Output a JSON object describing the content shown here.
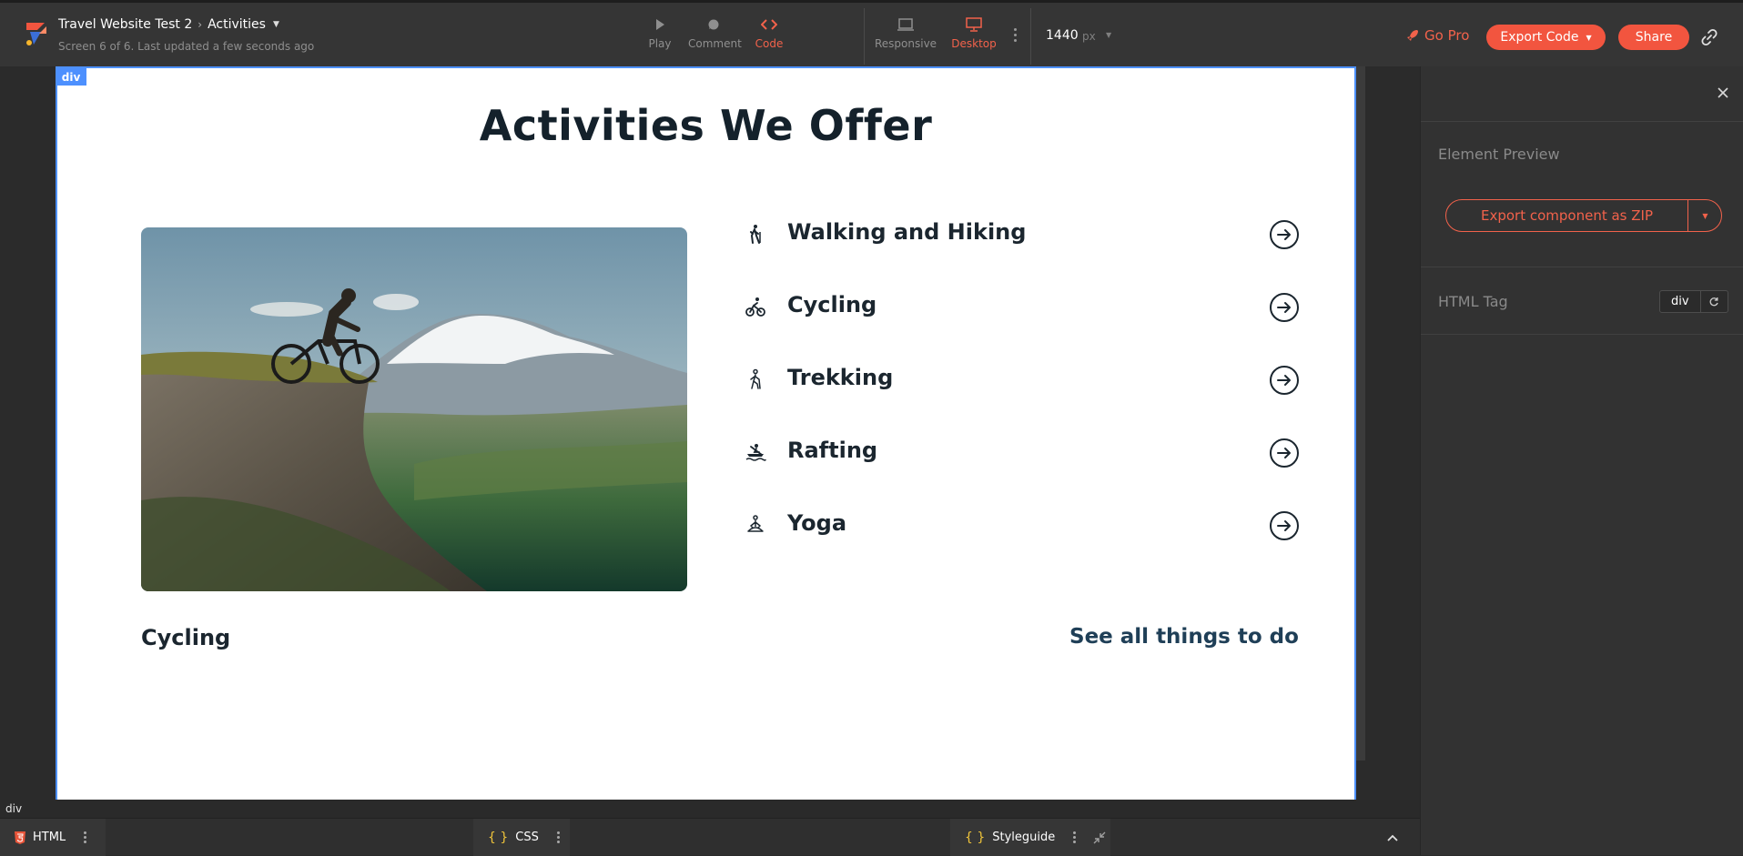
{
  "app": {
    "project_name": "Travel Website Test 2",
    "screen_name": "Activities",
    "subtitle": "Screen 6 of 6. Last updated a few seconds ago"
  },
  "toolbar": {
    "modes": [
      {
        "label": "Play",
        "icon": "play-icon"
      },
      {
        "label": "Comment",
        "icon": "comment-icon"
      },
      {
        "label": "Code",
        "icon": "code-icon",
        "active": true
      }
    ],
    "views": [
      {
        "label": "Responsive",
        "icon": "laptop-icon"
      },
      {
        "label": "Desktop",
        "icon": "desktop-icon",
        "active": true
      }
    ],
    "width_value": "1440",
    "width_unit": "px",
    "go_pro": "Go Pro",
    "export_code": "Export Code",
    "share": "Share",
    "accent_color": "#f2553f"
  },
  "canvas": {
    "selection_tag": "div",
    "selection_color": "#4d90fe",
    "heading": "Activities We Offer",
    "activities": [
      {
        "label": "Walking and Hiking",
        "icon": "hiking-icon"
      },
      {
        "label": "Cycling",
        "icon": "cycling-icon"
      },
      {
        "label": "Trekking",
        "icon": "trekking-icon"
      },
      {
        "label": "Rafting",
        "icon": "rafting-icon"
      },
      {
        "label": "Yoga",
        "icon": "yoga-icon"
      }
    ],
    "image_caption": "Cycling",
    "see_all": "See all things to do"
  },
  "panel": {
    "section_title": "Element Preview",
    "export_zip": "Export component as ZIP",
    "html_tag_label": "HTML Tag",
    "html_tag_value": "div"
  },
  "status": {
    "breadcrumb": "div"
  },
  "bottom_tabs": [
    {
      "label": "HTML",
      "icon": "html5-icon"
    },
    {
      "label": "CSS",
      "icon": "braces-icon"
    },
    {
      "label": "Styleguide",
      "icon": "braces-icon"
    }
  ]
}
